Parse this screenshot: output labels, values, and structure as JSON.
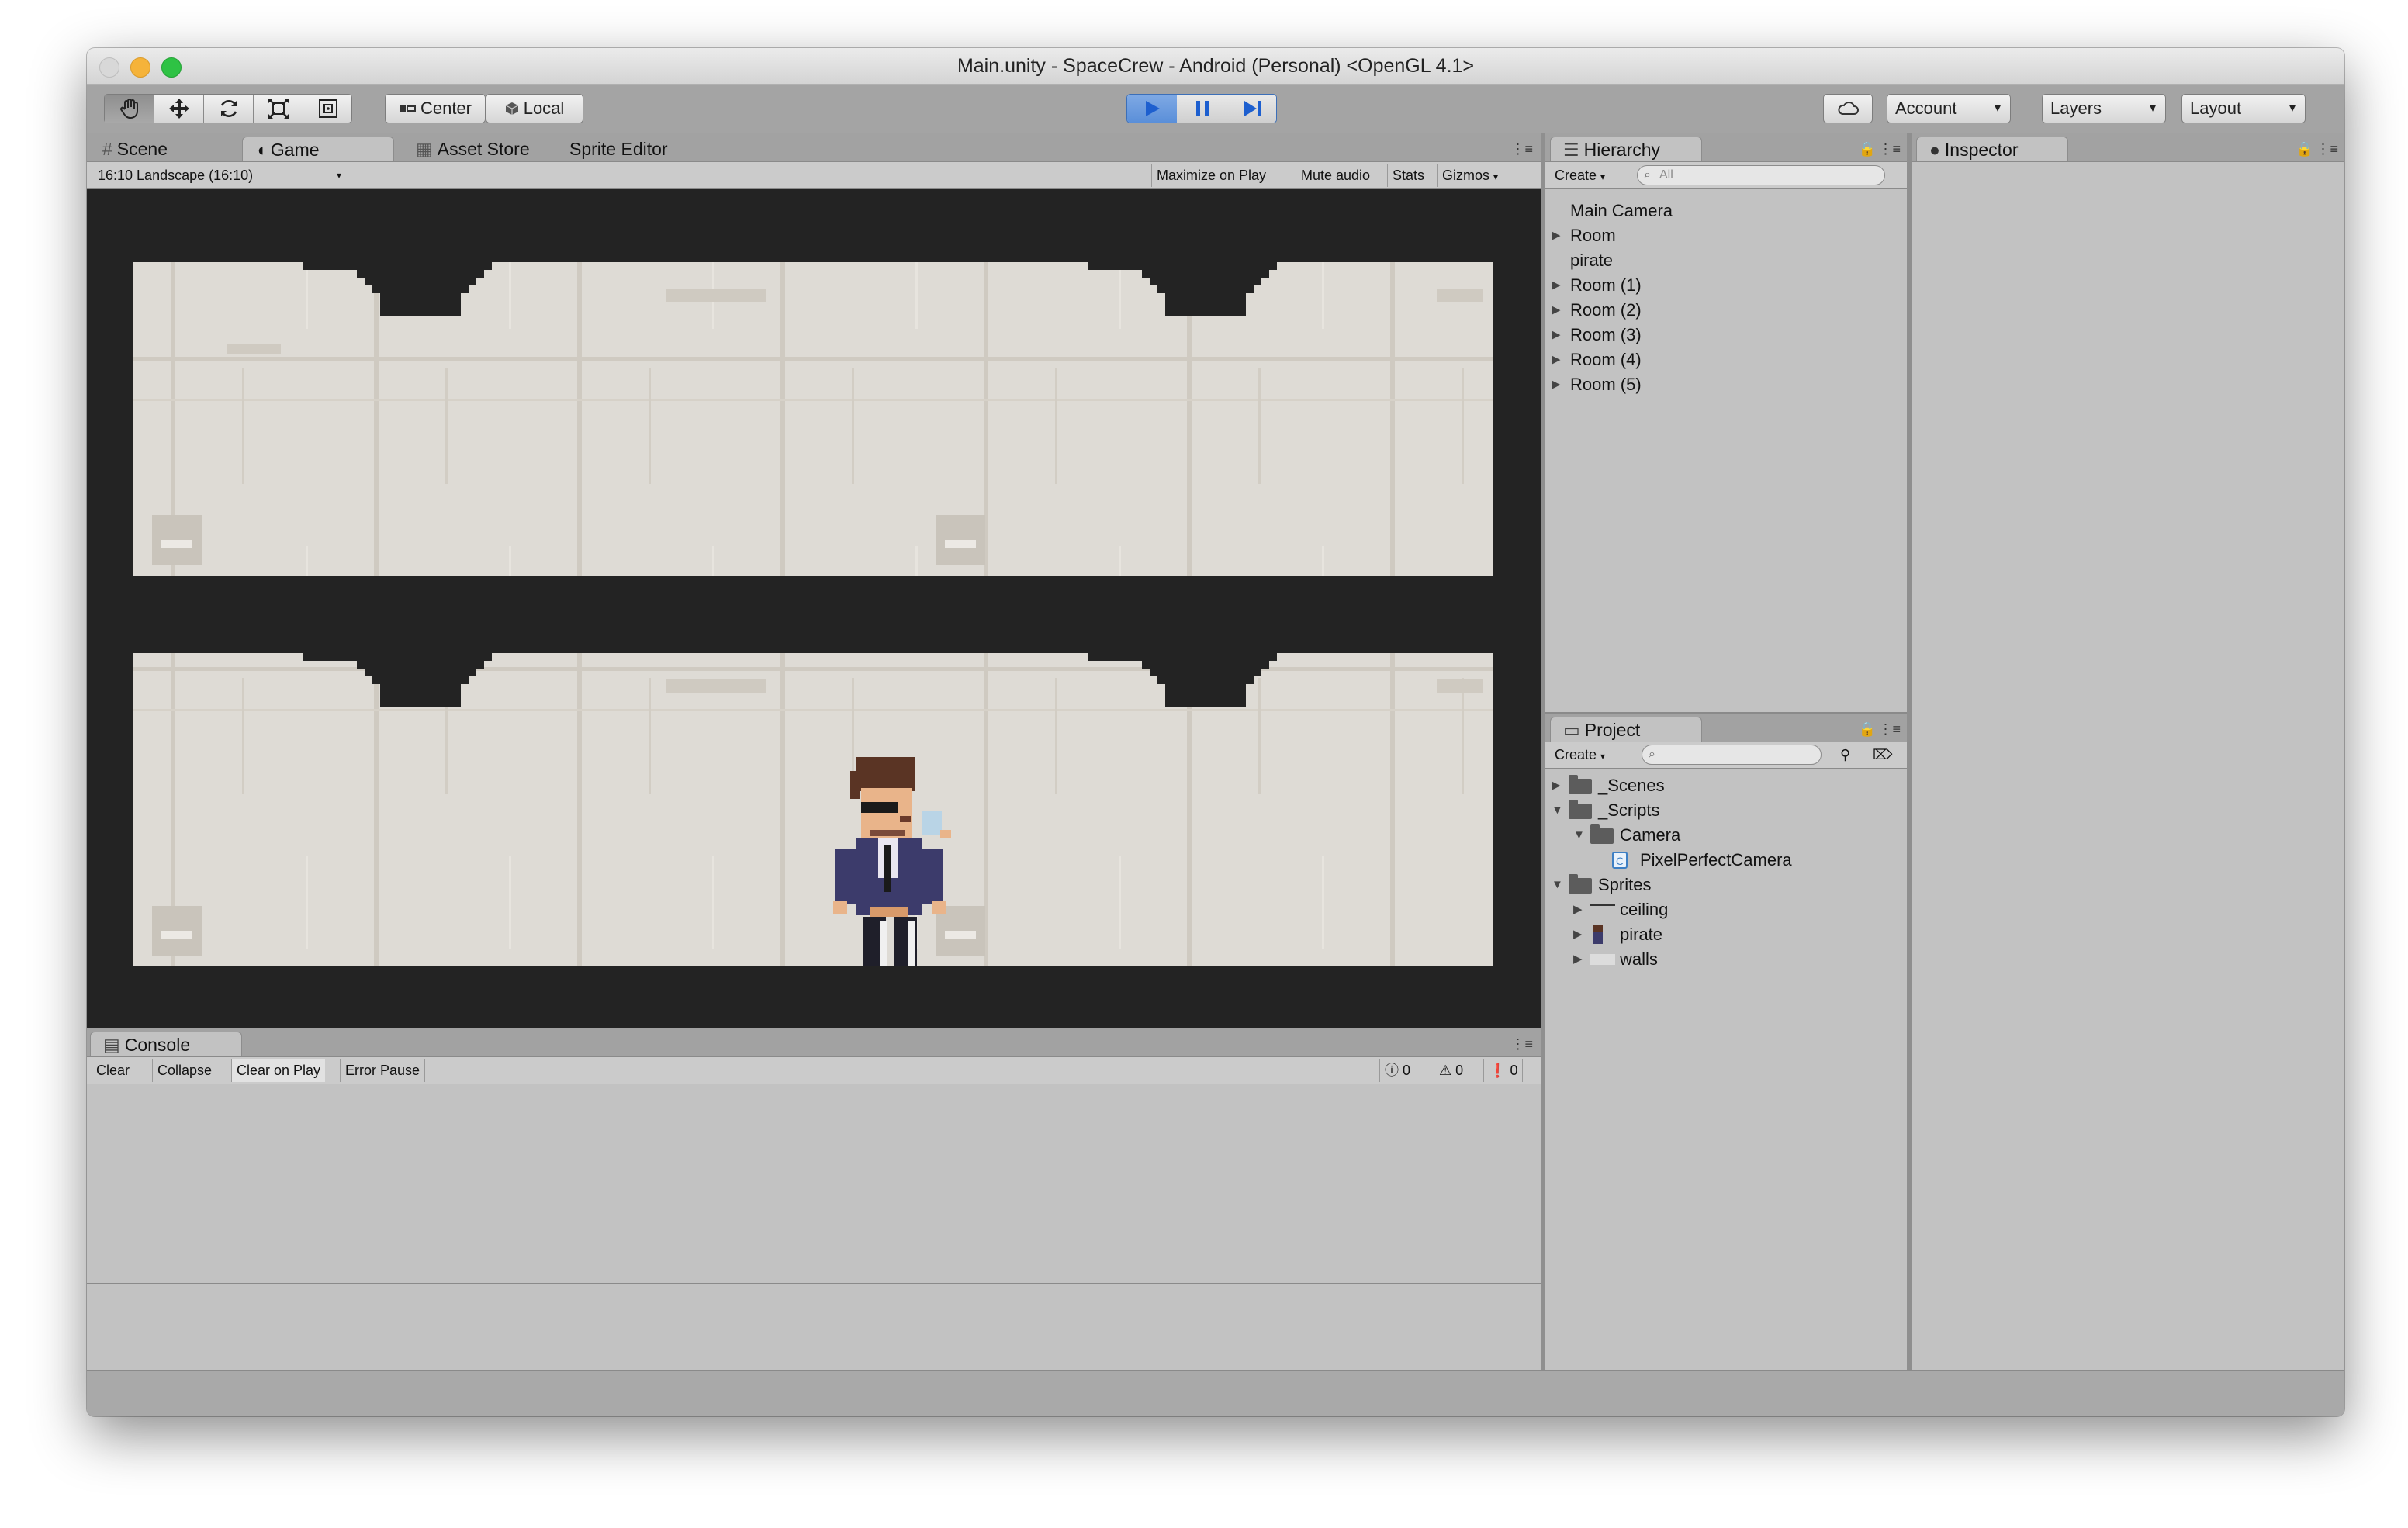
{
  "window": {
    "title": "Main.unity - SpaceCrew - Android (Personal) <OpenGL 4.1>"
  },
  "toolbar": {
    "tools": [
      "hand-tool-icon",
      "move-tool-icon",
      "rotate-tool-icon",
      "scale-tool-icon",
      "rect-tool-icon"
    ],
    "pivot_label": "Center",
    "space_label": "Local",
    "account_label": "Account",
    "layers_label": "Layers",
    "layout_label": "Layout"
  },
  "scene_tabs": {
    "scene": "Scene",
    "game": "Game",
    "asset_store": "Asset Store",
    "sprite_editor": "Sprite Editor"
  },
  "game_bar": {
    "aspect": "16:10 Landscape (16:10)",
    "maximize": "Maximize on Play",
    "mute": "Mute audio",
    "stats": "Stats",
    "gizmos": "Gizmos"
  },
  "hierarchy": {
    "title": "Hierarchy",
    "create": "Create",
    "search_placeholder": "All",
    "items": [
      {
        "label": "Main Camera",
        "expandable": false
      },
      {
        "label": "Room",
        "expandable": true
      },
      {
        "label": "pirate",
        "expandable": false
      },
      {
        "label": "Room (1)",
        "expandable": true
      },
      {
        "label": "Room (2)",
        "expandable": true
      },
      {
        "label": "Room (3)",
        "expandable": true
      },
      {
        "label": "Room (4)",
        "expandable": true
      },
      {
        "label": "Room (5)",
        "expandable": true
      }
    ]
  },
  "project": {
    "title": "Project",
    "create": "Create",
    "items": [
      {
        "label": "_Scenes"
      },
      {
        "label": "_Scripts"
      },
      {
        "label": "Camera"
      },
      {
        "label": "PixelPerfectCamera"
      },
      {
        "label": "Sprites"
      },
      {
        "label": "ceiling"
      },
      {
        "label": "pirate"
      },
      {
        "label": "walls"
      }
    ]
  },
  "inspector": {
    "title": "Inspector"
  },
  "console": {
    "title": "Console",
    "clear": "Clear",
    "collapse": "Collapse",
    "clear_on_play": "Clear on Play",
    "error_pause": "Error Pause",
    "info_count": "0",
    "warning_count": "0",
    "error_count": "0"
  },
  "colors": {
    "play_active": "#4a8ae6",
    "wall": "#dedbd5",
    "game_bg": "#232323"
  }
}
